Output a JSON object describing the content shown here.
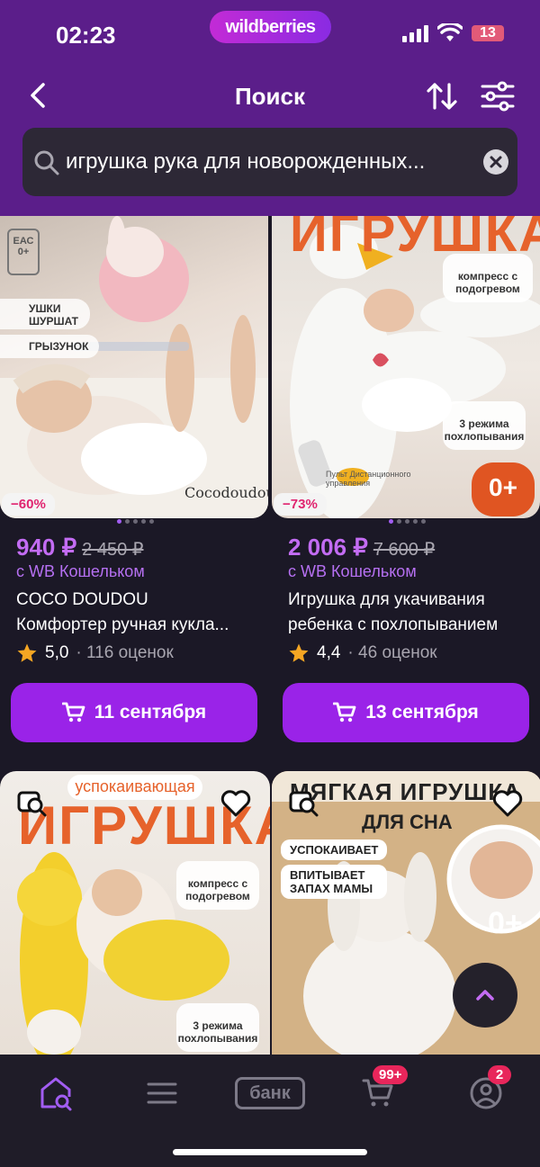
{
  "status_bar": {
    "time": "02:23",
    "battery": "13"
  },
  "brand": "wildberries",
  "nav": {
    "title": "Поиск",
    "back_icon": "chevron-left-icon",
    "sort_icon": "sort-arrows-icon",
    "filter_icon": "filter-sliders-icon"
  },
  "search": {
    "value": "игрушка рука для новорожденных..."
  },
  "products": [
    {
      "discount": "−60%",
      "price": "940 ₽",
      "old_price": "2 450 ₽",
      "wallet": "с WB Кошельком",
      "brand": "COCO DOUDOU",
      "title": "Комфортер ручная кукла...",
      "rating": "5,0",
      "reviews": "· 116 оценок",
      "delivery": "11 сентября",
      "image_text": {
        "tag1": "УШКИ ШУРШАТ",
        "tag2": "ГРЫЗУНОК",
        "cert": "ЕАС 0+",
        "logo": "Cocodoudou"
      }
    },
    {
      "discount": "−73%",
      "price": "2 006 ₽",
      "old_price": "7 600 ₽",
      "wallet": "с WB Кошельком",
      "brand": "Игрушка для укачивания",
      "title": "ребенка с похлопыванием",
      "rating": "4,4",
      "reviews": "· 46 оценок",
      "delivery": "13 сентября",
      "image_text": {
        "heading": "ИГРУШКА",
        "b1": "компресс с подогревом",
        "b2": "3 режима похлопывания",
        "age": "0+",
        "remote": "Пульт Дистанционного управления"
      }
    }
  ],
  "products_row2": [
    {
      "image_text": {
        "sub": "успокаивающая",
        "heading": "ИГРУШКА",
        "b1": "компресс с подогревом",
        "b2": "3 режима похлопывания"
      }
    },
    {
      "image_text": {
        "heading": "МЯГКАЯ ИГРУШКА",
        "sub": "ДЛЯ СНА",
        "l1": "УСПОКАИВАЕТ",
        "l2": "ВПИТЫВАЕТ ЗАПАХ МАМЫ",
        "age": "0+"
      }
    }
  ],
  "tabbar": {
    "bank": "банк",
    "cart_badge": "99+",
    "profile_badge": "2"
  },
  "colors": {
    "header": "#5b1e8a",
    "accent": "#9a23e8",
    "price": "#c36cf3",
    "badge": "#e8265b"
  }
}
